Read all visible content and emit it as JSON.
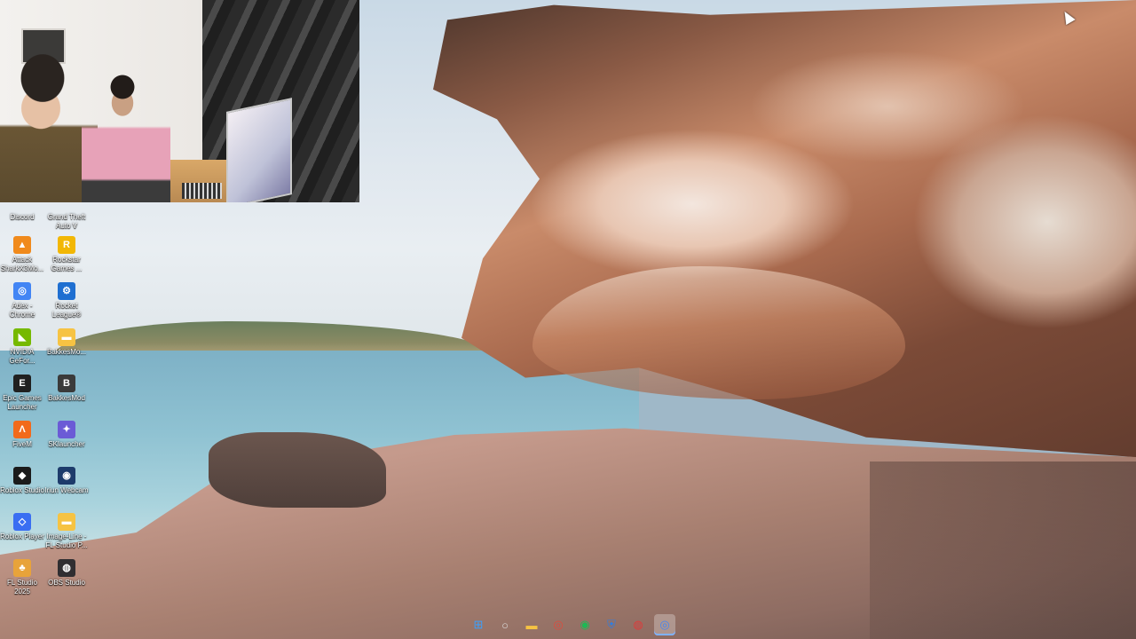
{
  "desktop_icons": [
    {
      "label": "Discord",
      "icon": "discord-icon",
      "color": "#5865F2",
      "glyph": "◉"
    },
    {
      "label": "Grand Theft Auto V",
      "icon": "gta-v-icon",
      "color": "#2b2b2b",
      "glyph": "V"
    },
    {
      "label": "Attack SharkX3Mo...",
      "icon": "attack-shark-icon",
      "color": "#f08a1c",
      "glyph": "▲"
    },
    {
      "label": "Rockstar Games ...",
      "icon": "rockstar-games-icon",
      "color": "#f2b705",
      "glyph": "R"
    },
    {
      "label": "Adex - Chrome",
      "icon": "chrome-icon",
      "color": "#4285F4",
      "glyph": "◎"
    },
    {
      "label": "Rocket League®",
      "icon": "rocket-league-icon",
      "color": "#1f6fd1",
      "glyph": "⚙"
    },
    {
      "label": "NVIDIA GeFor...",
      "icon": "nvidia-geforce-icon",
      "color": "#76b900",
      "glyph": "◣"
    },
    {
      "label": "BakkesMo...",
      "icon": "folder-icon",
      "color": "#f6c343",
      "glyph": "▬"
    },
    {
      "label": "Epic Games Launcher",
      "icon": "epic-games-icon",
      "color": "#202020",
      "glyph": "E"
    },
    {
      "label": "BakkesMod",
      "icon": "bakkesmod-icon",
      "color": "#3a3a3a",
      "glyph": "B"
    },
    {
      "label": "FiveM",
      "icon": "fivem-icon",
      "color": "#f26a1b",
      "glyph": "Λ"
    },
    {
      "label": "SKlauncher",
      "icon": "sklauncher-icon",
      "color": "#6b5bd6",
      "glyph": "✦"
    },
    {
      "label": "Roblox Studio",
      "icon": "roblox-studio-icon",
      "color": "#1b1b1b",
      "glyph": "◆"
    },
    {
      "label": "Iriun Webcam",
      "icon": "iriun-webcam-icon",
      "color": "#1d3b6b",
      "glyph": "◉"
    },
    {
      "label": "Roblox Player",
      "icon": "roblox-player-icon",
      "color": "#3a6ef2",
      "glyph": "◇"
    },
    {
      "label": "Image-Line - FL Studio P...",
      "icon": "folder-icon",
      "color": "#f6c343",
      "glyph": "▬"
    },
    {
      "label": "FL Studio 2025",
      "icon": "fl-studio-icon",
      "color": "#e8a33a",
      "glyph": "♣"
    },
    {
      "label": "OBS Studio",
      "icon": "obs-studio-icon",
      "color": "#302e31",
      "glyph": "◍"
    }
  ],
  "taskbar": [
    {
      "name": "start-button",
      "icon": "windows-start-icon",
      "glyph": "⊞",
      "color": "#3aa0ff"
    },
    {
      "name": "search-button",
      "icon": "search-icon",
      "glyph": "○",
      "color": "#dddddd"
    },
    {
      "name": "file-explorer-button",
      "icon": "file-explorer-icon",
      "glyph": "▬",
      "color": "#f6c343"
    },
    {
      "name": "chrome-button",
      "icon": "chrome-icon",
      "glyph": "◎",
      "color": "#e04a3c"
    },
    {
      "name": "spotify-button",
      "icon": "spotify-icon",
      "glyph": "◉",
      "color": "#1db954"
    },
    {
      "name": "defender-button",
      "icon": "shield-icon",
      "glyph": "⛨",
      "color": "#2f7de0"
    },
    {
      "name": "obs-button",
      "icon": "obs-recording-icon",
      "glyph": "◍",
      "color": "#e03a3a"
    },
    {
      "name": "chrome-active-button",
      "icon": "chrome-icon",
      "glyph": "◎",
      "color": "#4285F4"
    }
  ]
}
